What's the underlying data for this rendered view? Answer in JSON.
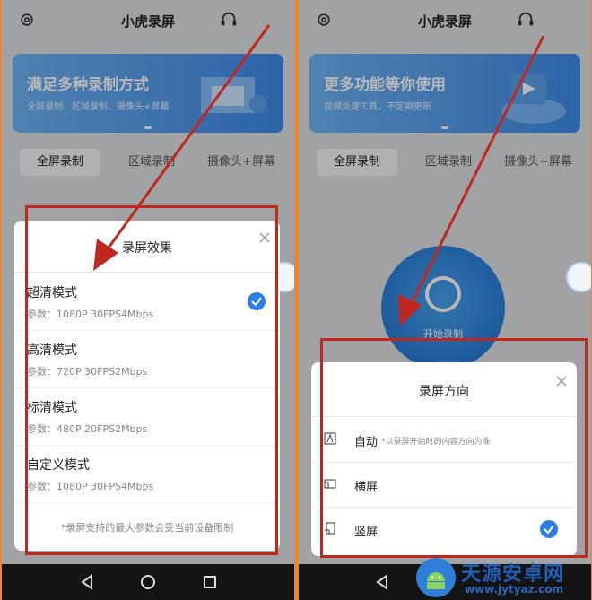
{
  "app_title": "小虎录屏",
  "left": {
    "banner": {
      "title": "满足多种录制方式",
      "subtitle": "全屏录制、区域录制、摄像头+屏幕"
    },
    "tabs": [
      "全屏录制",
      "区域录制",
      "摄像头+屏幕"
    ],
    "sheet": {
      "title": "录屏效果",
      "options": [
        {
          "name": "超清模式",
          "params": "参数：1080P 30FPS4Mbps",
          "selected": true
        },
        {
          "name": "高清模式",
          "params": "参数：720P 30FPS2Mbps",
          "selected": false
        },
        {
          "name": "标清模式",
          "params": "参数：480P 20FPS2Mbps",
          "selected": false
        },
        {
          "name": "自定义模式",
          "params": "参数：1080P 30FPS4Mbps",
          "selected": false
        }
      ],
      "note": "*录屏支持的最大参数会受当前设备限制"
    }
  },
  "right": {
    "banner": {
      "title": "更多功能等你使用",
      "subtitle": "视频处理工具，不定期更新"
    },
    "tabs": [
      "全屏录制",
      "区域录制",
      "摄像头+屏幕"
    ],
    "record_label": "开始录制",
    "sheet": {
      "title": "录屏方向",
      "options": [
        {
          "name": "自动",
          "hint": "*以录屏开始时的内容方向为准",
          "selected": false
        },
        {
          "name": "横屏",
          "hint": "",
          "selected": false
        },
        {
          "name": "竖屏",
          "hint": "",
          "selected": true
        }
      ]
    }
  },
  "watermark": {
    "name": "天源安卓网",
    "url": "www.jytyaz.com"
  },
  "colors": {
    "accent": "#2d7de6",
    "annotation": "#c0281f",
    "frame": "#e8873a"
  }
}
